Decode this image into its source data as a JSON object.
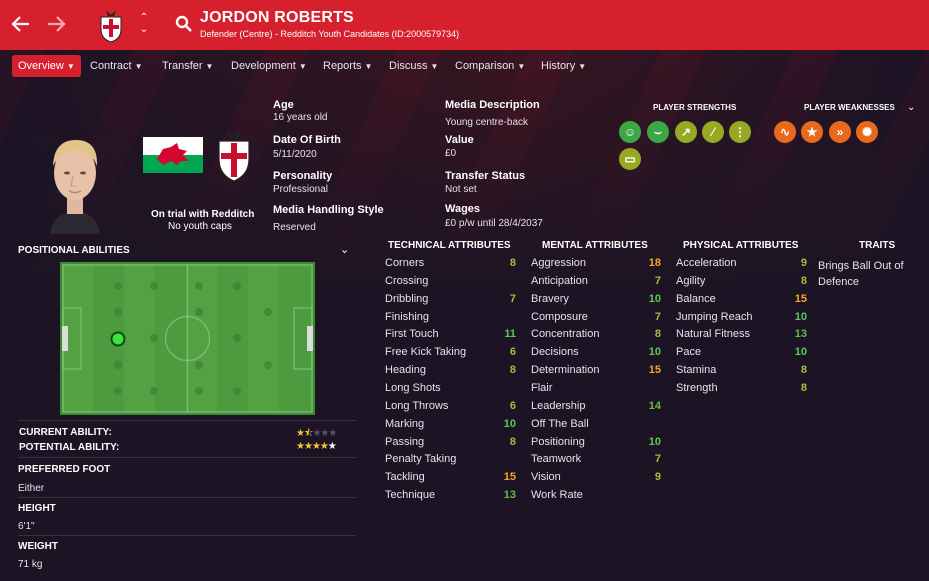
{
  "header": {
    "name": "JORDON ROBERTS",
    "subtitle": "Defender (Centre) - Redditch Youth Candidates (ID:2000579734)",
    "back_icon": "arrow-left-icon",
    "forward_icon": "arrow-right-icon",
    "search_icon": "search-icon"
  },
  "nav": {
    "items": [
      {
        "label": "Overview"
      },
      {
        "label": "Contract"
      },
      {
        "label": "Transfer"
      },
      {
        "label": "Development"
      },
      {
        "label": "Reports"
      },
      {
        "label": "Discuss"
      },
      {
        "label": "Comparison"
      },
      {
        "label": "History"
      }
    ],
    "active": "Overview"
  },
  "profile": {
    "trial_text": "On trial with Redditch",
    "caps_text": "No youth caps",
    "age_label": "Age",
    "age_value": "16 years old",
    "dob_label": "Date Of Birth",
    "dob_value": "5/11/2020",
    "personality_label": "Personality",
    "personality_value": "Professional",
    "media_style_label": "Media Handling Style",
    "media_style_value": "Reserved",
    "media_desc_label": "Media Description",
    "media_desc_value": "Young centre-back",
    "value_label": "Value",
    "value_value": "£0",
    "transfer_status_label": "Transfer Status",
    "transfer_status_value": "Not set",
    "wages_label": "Wages",
    "wages_value": "£0 p/w until 28/4/2037"
  },
  "strengths": {
    "title": "PLAYER STRENGTHS",
    "icons": [
      "head-icon",
      "pass-icon",
      "trend-icon",
      "bone-icon",
      "foot-icon",
      "pitch-icon"
    ]
  },
  "weaknesses": {
    "title": "PLAYER WEAKNESSES",
    "icons": [
      "heartbeat-icon",
      "star-icon",
      "boot-icon",
      "burst-icon"
    ]
  },
  "positional": {
    "title": "POSITIONAL ABILITIES",
    "current_ability_label": "CURRENT ABILITY:",
    "potential_ability_label": "POTENTIAL ABILITY:",
    "current_ability_stars": 1.5,
    "potential_ability_stars": 4.5
  },
  "physical_info": {
    "foot_label": "PREFERRED FOOT",
    "foot_value": "Either",
    "height_label": "HEIGHT",
    "height_value": "6'1\"",
    "weight_label": "WEIGHT",
    "weight_value": "71 kg"
  },
  "technical": {
    "title": "TECHNICAL ATTRIBUTES",
    "rows": [
      {
        "name": "Corners",
        "value": "8"
      },
      {
        "name": "Crossing",
        "value": ""
      },
      {
        "name": "Dribbling",
        "value": "7"
      },
      {
        "name": "Finishing",
        "value": ""
      },
      {
        "name": "First Touch",
        "value": "11"
      },
      {
        "name": "Free Kick Taking",
        "value": "6"
      },
      {
        "name": "Heading",
        "value": "8"
      },
      {
        "name": "Long Shots",
        "value": ""
      },
      {
        "name": "Long Throws",
        "value": "6"
      },
      {
        "name": "Marking",
        "value": "10"
      },
      {
        "name": "Passing",
        "value": "8"
      },
      {
        "name": "Penalty Taking",
        "value": ""
      },
      {
        "name": "Tackling",
        "value": "15"
      },
      {
        "name": "Technique",
        "value": "13"
      }
    ]
  },
  "mental": {
    "title": "MENTAL ATTRIBUTES",
    "rows": [
      {
        "name": "Aggression",
        "value": "18"
      },
      {
        "name": "Anticipation",
        "value": "7"
      },
      {
        "name": "Bravery",
        "value": "10"
      },
      {
        "name": "Composure",
        "value": "7"
      },
      {
        "name": "Concentration",
        "value": "8"
      },
      {
        "name": "Decisions",
        "value": "10"
      },
      {
        "name": "Determination",
        "value": "15"
      },
      {
        "name": "Flair",
        "value": ""
      },
      {
        "name": "Leadership",
        "value": "14"
      },
      {
        "name": "Off The Ball",
        "value": ""
      },
      {
        "name": "Positioning",
        "value": "10"
      },
      {
        "name": "Teamwork",
        "value": "7"
      },
      {
        "name": "Vision",
        "value": "9"
      },
      {
        "name": "Work Rate",
        "value": ""
      }
    ]
  },
  "physical": {
    "title": "PHYSICAL ATTRIBUTES",
    "rows": [
      {
        "name": "Acceleration",
        "value": "9"
      },
      {
        "name": "Agility",
        "value": "8"
      },
      {
        "name": "Balance",
        "value": "15"
      },
      {
        "name": "Jumping Reach",
        "value": "10"
      },
      {
        "name": "Natural Fitness",
        "value": "13"
      },
      {
        "name": "Pace",
        "value": "10"
      },
      {
        "name": "Stamina",
        "value": "8"
      },
      {
        "name": "Strength",
        "value": "8"
      }
    ]
  },
  "traits": {
    "title": "TRAITS",
    "value": "Brings Ball Out of Defence"
  },
  "colors": {
    "header_red": "#d6202e",
    "good": "#5cc85a",
    "great": "#f4a820",
    "pitch": "#4d9b3e"
  }
}
